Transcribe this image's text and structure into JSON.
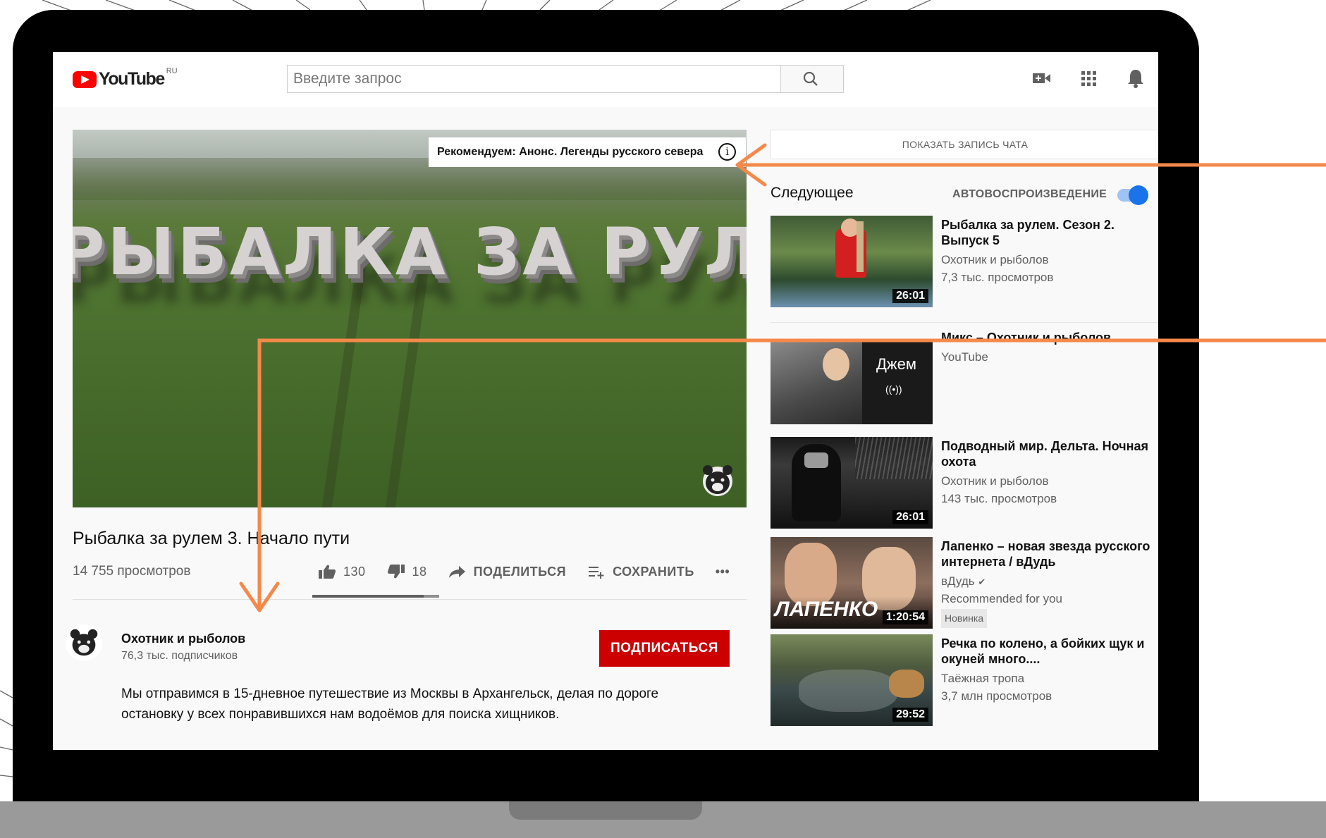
{
  "header": {
    "logo_text": "YouTube",
    "region": "RU",
    "search_placeholder": "Введите запрос",
    "icons": [
      "video-camera-icon",
      "apps-grid-icon",
      "bell-icon"
    ]
  },
  "player": {
    "overlay_title": "РЫБАЛКА ЗА РУЛЕМ",
    "recommendation": "Рекомендуем: Анонс. Легенды русского севера",
    "info_symbol": "i"
  },
  "video": {
    "title": "Рыбалка за рулем 3. Начало пути",
    "views": "14 755 просмотров",
    "likes": "130",
    "dislikes": "18",
    "share_label": "ПОДЕЛИТЬСЯ",
    "save_label": "СОХРАНИТЬ",
    "more_label": "•••",
    "like_ratio": 0.878
  },
  "channel": {
    "name": "Охотник и рыболов",
    "subscribers": "76,3 тыс. подписчиков",
    "subscribe_label": "ПОДПИСАТЬСЯ",
    "description_lines": [
      "Мы отправимся в 15-дневное путешествие из Москвы в Архангельск, делая по дороге",
      "остановку у всех понравившихся нам водоёмов для поиска хищников."
    ]
  },
  "sidebar": {
    "chat_button": "ПОКАЗАТЬ ЗАПИСЬ ЧАТА",
    "up_next": "Следующее",
    "autoplay_label": "АВТОВОСПРОИЗВЕДЕНИЕ",
    "autoplay_on": true,
    "items": [
      {
        "title": "Рыбалка за рулем. Сезон 2. Выпуск 5",
        "channel": "Охотник и рыболов",
        "views": "7,3 тыс. просмотров",
        "duration": "26:01"
      },
      {
        "title": "Микс – Охотник и рыболов",
        "channel": "YouTube",
        "thumb_label": "Джем",
        "thumb_glyph": "((•))"
      },
      {
        "title": "Подводный мир. Дельта. Ночная охота",
        "channel": "Охотник и рыболов",
        "views": "143 тыс. просмотров",
        "duration": "26:01"
      },
      {
        "title": "Лапенко – новая звезда русского интернета / вДудь",
        "channel": "вДудь",
        "verified_glyph": "✔",
        "note": "Recommended for you",
        "badge": "Новинка",
        "thumb_label": "ЛАПЕНКО",
        "duration": "1:20:54"
      },
      {
        "title": "Речка по колено, а бойких щук и окуней много....",
        "channel": "Таёжная тропа",
        "views": "3,7 млн просмотров",
        "duration": "29:52"
      }
    ]
  },
  "colors": {
    "accent_arrow": "#f4894a",
    "subscribe_red": "#cc0000",
    "toggle_blue": "#1a73e8",
    "laptop_frame": "#000000"
  }
}
